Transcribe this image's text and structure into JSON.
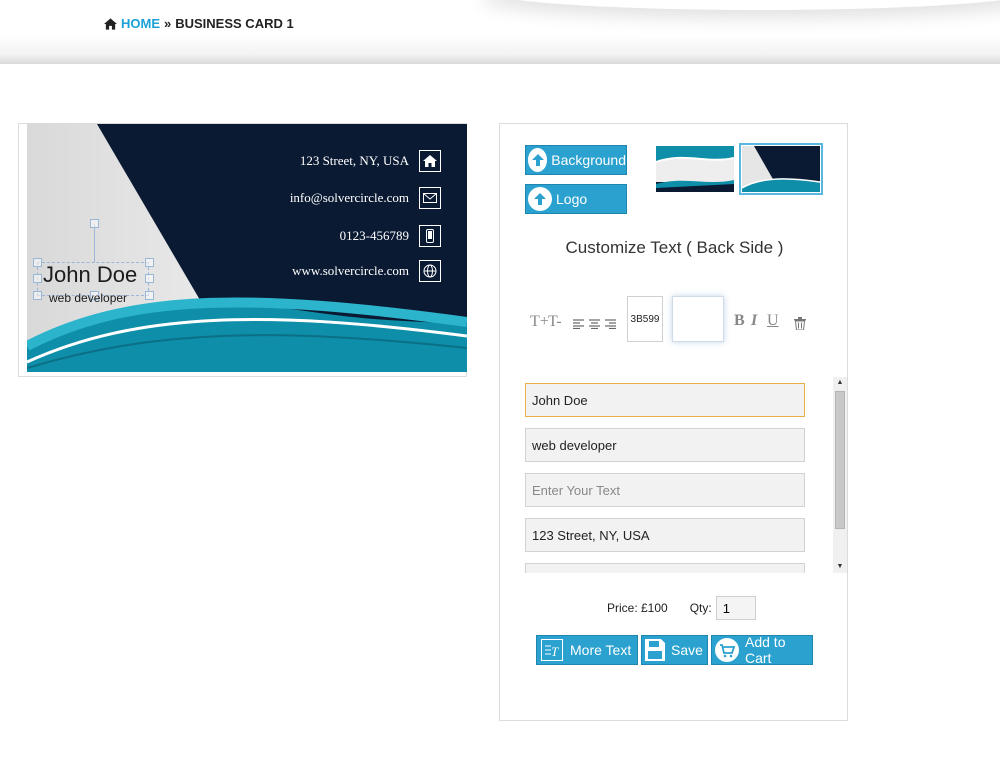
{
  "breadcrumb": {
    "home": "HOME",
    "separator": "»",
    "current": "BUSINESS CARD 1"
  },
  "card": {
    "name": "John Doe",
    "title": "web developer",
    "contacts": [
      {
        "text": "123 Street, NY, USA",
        "icon": "home-icon"
      },
      {
        "text": "info@solvercircle.com",
        "icon": "mail-icon"
      },
      {
        "text": "0123-456789",
        "icon": "phone-icon"
      },
      {
        "text": "www.solvercircle.com",
        "icon": "globe-icon"
      }
    ],
    "colors": {
      "navy": "#0b1a33",
      "teal": "#0e8ea8",
      "light_teal": "#25a9c2"
    }
  },
  "panel": {
    "background_button": "Background",
    "logo_button": "Logo",
    "customize_title": "Customize Text ( Back Side )",
    "toolbar": {
      "increase_font": "T+",
      "decrease_font": "T-",
      "color_value": "3B599",
      "bold": "B",
      "italic": "I",
      "underline": "U"
    },
    "fields": [
      {
        "value": "John Doe",
        "placeholder": ""
      },
      {
        "value": "web developer",
        "placeholder": ""
      },
      {
        "value": "",
        "placeholder": "Enter Your Text"
      },
      {
        "value": "123 Street, NY, USA",
        "placeholder": ""
      },
      {
        "value": "",
        "placeholder": ""
      }
    ],
    "price_label": "Price: £100",
    "qty_label": "Qty:",
    "qty_value": "1",
    "more_text_button": "More Text",
    "save_button": "Save",
    "add_to_cart_button": "Add to Cart",
    "accent_color": "#2aa1cf"
  }
}
